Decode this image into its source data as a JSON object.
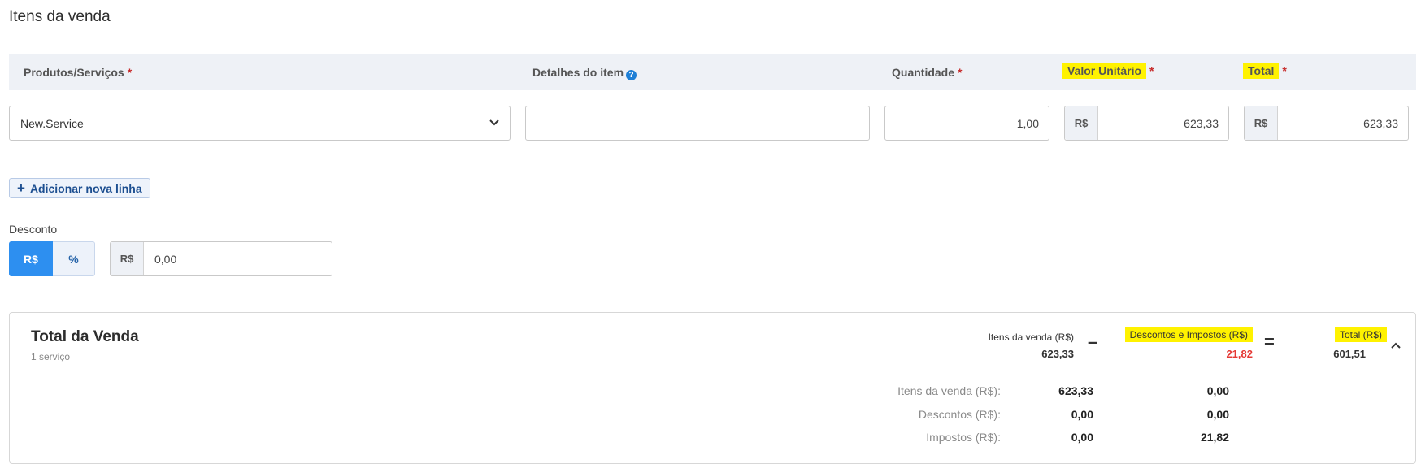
{
  "section": {
    "title": "Itens da venda"
  },
  "columns": {
    "products": "Produtos/Serviços",
    "details": "Detalhes do item",
    "quantity": "Quantidade",
    "unit_value": "Valor Unitário",
    "total": "Total",
    "required_mark": "*",
    "help_icon": "question-circle-icon"
  },
  "row": {
    "product": "New.Service",
    "details": "",
    "quantity": "1,00",
    "currency_prefix": "R$",
    "unit_value": "623,33",
    "total": "623,33"
  },
  "add_line": {
    "label": "Adicionar nova linha",
    "icon": "+"
  },
  "discount": {
    "label": "Desconto",
    "mode_rs": "R$",
    "mode_pct": "%",
    "selected": "R$",
    "prefix": "R$",
    "value": "0,00"
  },
  "summary": {
    "title": "Total da Venda",
    "subtitle": "1 serviço",
    "items_label": "Itens da venda (R$)",
    "items_value": "623,33",
    "minus": "–",
    "disc_tax_label": "Descontos e Impostos (R$)",
    "disc_tax_value": "21,82",
    "equals": "=",
    "total_label": "Total (R$)",
    "total_value": "601,51",
    "breakdown": [
      {
        "label": "Itens da venda (R$):",
        "col1": "623,33",
        "col2": "0,00"
      },
      {
        "label": "Descontos (R$):",
        "col1": "0,00",
        "col2": "0,00"
      },
      {
        "label": "Impostos (R$):",
        "col1": "0,00",
        "col2": "21,82"
      }
    ]
  },
  "colors": {
    "accent": "#2d8ff0",
    "highlight": "#fff200",
    "negative": "#e53935",
    "required": "#c62828"
  }
}
